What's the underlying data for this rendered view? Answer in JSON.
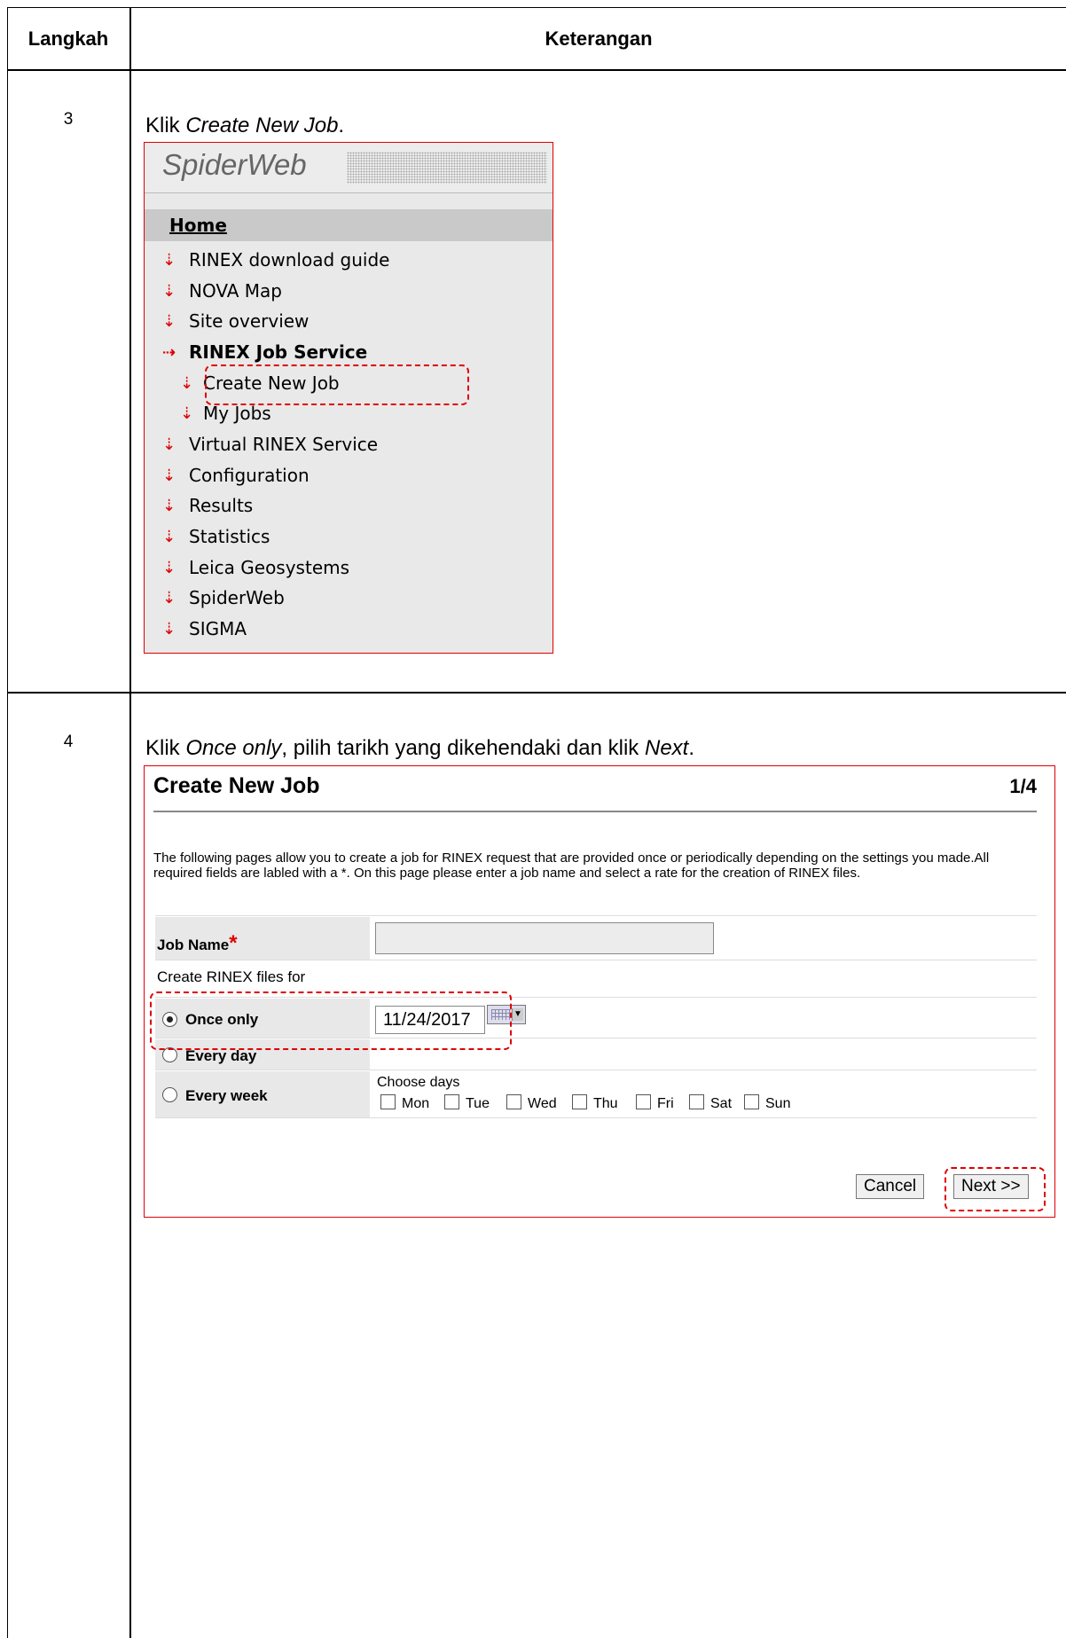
{
  "table": {
    "headers": {
      "step": "Langkah",
      "description": "Keterangan"
    },
    "rows": [
      {
        "step": "3",
        "instruction_pre": "Klik ",
        "instruction_em": "Create New Job",
        "instruction_post": "."
      },
      {
        "step": "4",
        "instruction_pre": "Klik ",
        "instruction_em": "Once only",
        "instruction_mid": ", pilih tarikh yang dikehendaki dan klik ",
        "instruction_em2": "Next",
        "instruction_post": "."
      }
    ]
  },
  "spiderweb": {
    "logo": "SpiderWeb",
    "home": "Home",
    "menu": [
      "RINEX download guide",
      "NOVA Map",
      "Site overview",
      "RINEX Job Service",
      "Create New Job",
      "My Jobs",
      "Virtual RINEX Service",
      "Configuration",
      "Results",
      "Statistics",
      "Leica Geosystems",
      "SpiderWeb",
      "SIGMA"
    ]
  },
  "create_job": {
    "title": "Create New Job",
    "page": "1/4",
    "description": "The following pages allow you to create a job for RINEX request that are provided once or periodically depending on the settings you made.All required fields are labled with a *. On this page please enter a job name and select a rate for the creation of RINEX files.",
    "job_name_label": "Job Name",
    "required_mark": "*",
    "job_name_value": "",
    "create_for_label": "Create RINEX files for",
    "options": {
      "once": "Once only",
      "day": "Every day",
      "week": "Every week"
    },
    "date_value": "11/24/2017",
    "choose_days_label": "Choose days",
    "days": [
      "Mon",
      "Tue",
      "Wed",
      "Thu",
      "Fri",
      "Sat",
      "Sun"
    ],
    "cancel": "Cancel",
    "next": "Next >>"
  }
}
